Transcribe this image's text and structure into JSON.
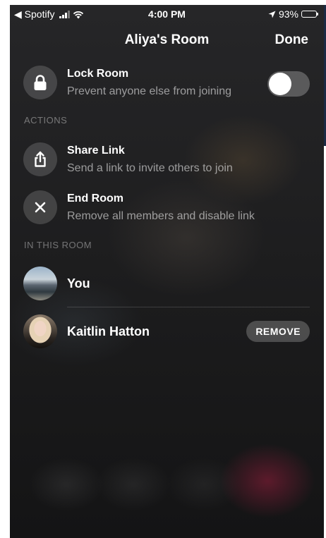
{
  "status_bar": {
    "carrier_back": "◀ Spotify",
    "time": "4:00 PM",
    "battery_pct": "93%",
    "battery_level": 0.93
  },
  "nav": {
    "title": "Aliya's Room",
    "done_label": "Done"
  },
  "lock_room": {
    "title": "Lock Room",
    "subtitle": "Prevent anyone else from joining",
    "toggle_on": false
  },
  "actions": {
    "section_label": "ACTIONS",
    "items": [
      {
        "title": "Share Link",
        "subtitle": "Send a link to invite others to join",
        "icon": "share-icon"
      },
      {
        "title": "End Room",
        "subtitle": "Remove all members and disable link",
        "icon": "close-icon"
      }
    ]
  },
  "members": {
    "section_label": "IN THIS ROOM",
    "items": [
      {
        "name": "You"
      },
      {
        "name": "Kaitlin Hatton",
        "action_label": "REMOVE"
      }
    ]
  }
}
